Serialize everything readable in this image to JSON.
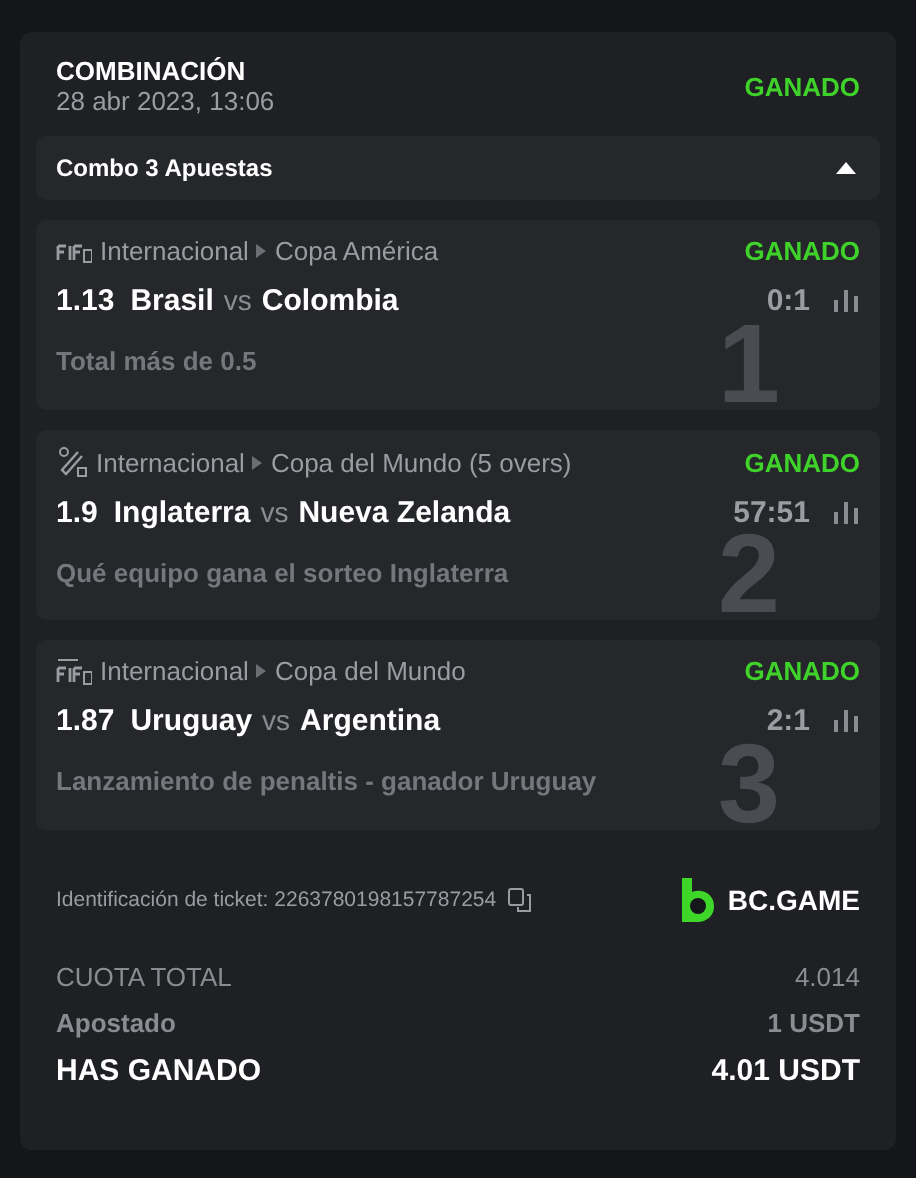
{
  "bet": {
    "type": "COMBINACIÓN",
    "date": "28 abr 2023, 13:06",
    "status": "GANADO"
  },
  "combo": {
    "label": "Combo 3 Apuestas",
    "expanded": true
  },
  "legs": [
    {
      "index": "1",
      "kind": "fifa",
      "country": "Internacional",
      "league": "Copa América",
      "status": "GANADO",
      "odds": "1.13",
      "home": "Brasil",
      "vs": "vs",
      "away": "Colombia",
      "score": "0:1",
      "market": "Total más de 0.5"
    },
    {
      "index": "2",
      "kind": "cricket",
      "country": "Internacional",
      "league": "Copa del Mundo (5 overs)",
      "status": "GANADO",
      "odds": "1.9",
      "home": "Inglaterra",
      "vs": "vs",
      "away": "Nueva Zelanda",
      "score": "57:51",
      "market": "Qué equipo gana el sorteo Inglaterra"
    },
    {
      "index": "3",
      "kind": "penalty",
      "country": "Internacional",
      "league": "Copa del Mundo",
      "status": "GANADO",
      "odds": "1.87",
      "home": "Uruguay",
      "vs": "vs",
      "away": "Argentina",
      "score": "2:1",
      "market": "Lanzamiento de penaltis - ganador Uruguay"
    }
  ],
  "ticket": {
    "label": "Identificación de ticket: 2263780198157787254",
    "brand": "BC.GAME"
  },
  "totals": [
    {
      "kind": "normal",
      "label": "CUOTA TOTAL",
      "value": "4.014"
    },
    {
      "kind": "normal",
      "label": "Apostado",
      "value": "1 USDT"
    },
    {
      "kind": "strong",
      "label": "HAS GANADO",
      "value": "4.01 USDT"
    }
  ]
}
